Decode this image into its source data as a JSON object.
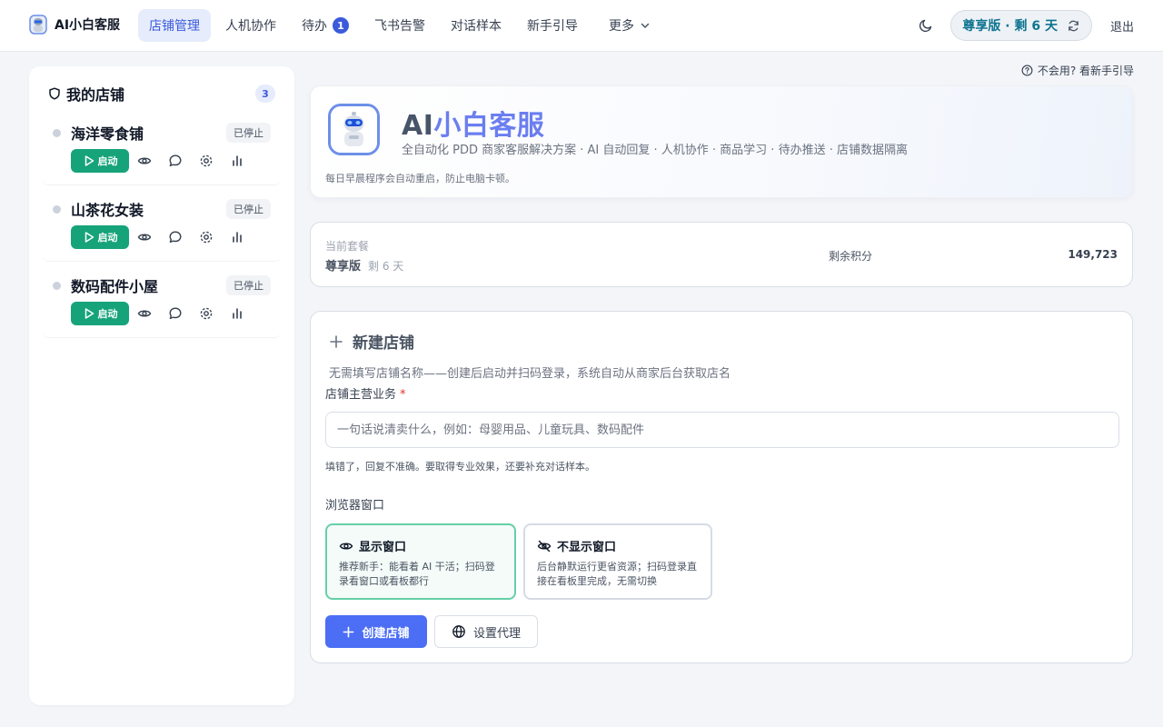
{
  "app": {
    "name": "AI小白客服",
    "logo_icon": "robot-logo-icon"
  },
  "nav": {
    "items": [
      {
        "label": "店铺管理",
        "active": true
      },
      {
        "label": "人机协作"
      },
      {
        "label": "待办",
        "badge": "1"
      },
      {
        "label": "飞书告警"
      },
      {
        "label": "对话样本"
      },
      {
        "label": "新手引导"
      },
      {
        "label": "更多",
        "icon": "chevron-down-icon"
      }
    ],
    "plan_pill": "尊享版 · 剩 6 天",
    "logout": "退出"
  },
  "sidebar": {
    "title": "我的店铺",
    "count": "3",
    "start_label": "启动",
    "shops": [
      {
        "name": "海洋零食铺",
        "status": "已停止"
      },
      {
        "name": "山茶花女装",
        "status": "已停止"
      },
      {
        "name": "数码配件小屋",
        "status": "已停止"
      }
    ]
  },
  "help": {
    "text": "不会用? 看新手引导"
  },
  "hero": {
    "title_prefix": "AI",
    "title_suffix": "小白客服",
    "subtitle": "全自动化 PDD 商家客服解决方案 · AI 自动回复 · 人机协作 · 商品学习 · 待办推送 · 店铺数据隔离",
    "note": "每日早晨程序会自动重启，防止电脑卡顿。"
  },
  "plan": {
    "label": "当前套餐",
    "name": "尊享版",
    "days": "剩 6 天",
    "points_label": "剩余积分",
    "points_value": "149,723"
  },
  "create": {
    "title": "新建店铺",
    "desc": "无需填写店铺名称——创建后启动并扫码登录，系统自动从商家后台获取店名",
    "biz_label": "店铺主营业务",
    "required_mark": "*",
    "biz_value": "",
    "biz_placeholder": "一句话说清卖什么，例如：母婴用品、儿童玩具、数码配件",
    "hint": "填错了，回复不准确。要取得专业效果，还要补充对话样本。",
    "window_label": "浏览器窗口",
    "options": [
      {
        "title": "显示窗口",
        "desc": "推荐新手：能看着 AI 干活；扫码登录看窗口或看板都行",
        "selected": true
      },
      {
        "title": "不显示窗口",
        "desc": "后台静默运行更省资源；扫码登录直接在看板里完成，无需切换",
        "selected": false
      }
    ],
    "create_button": "创建店铺",
    "proxy_button": "设置代理"
  },
  "colors": {
    "primary": "#4c6ef5",
    "success": "#16a37a",
    "plan_text": "#0e7490",
    "title_accent": "#6b7ef0"
  }
}
